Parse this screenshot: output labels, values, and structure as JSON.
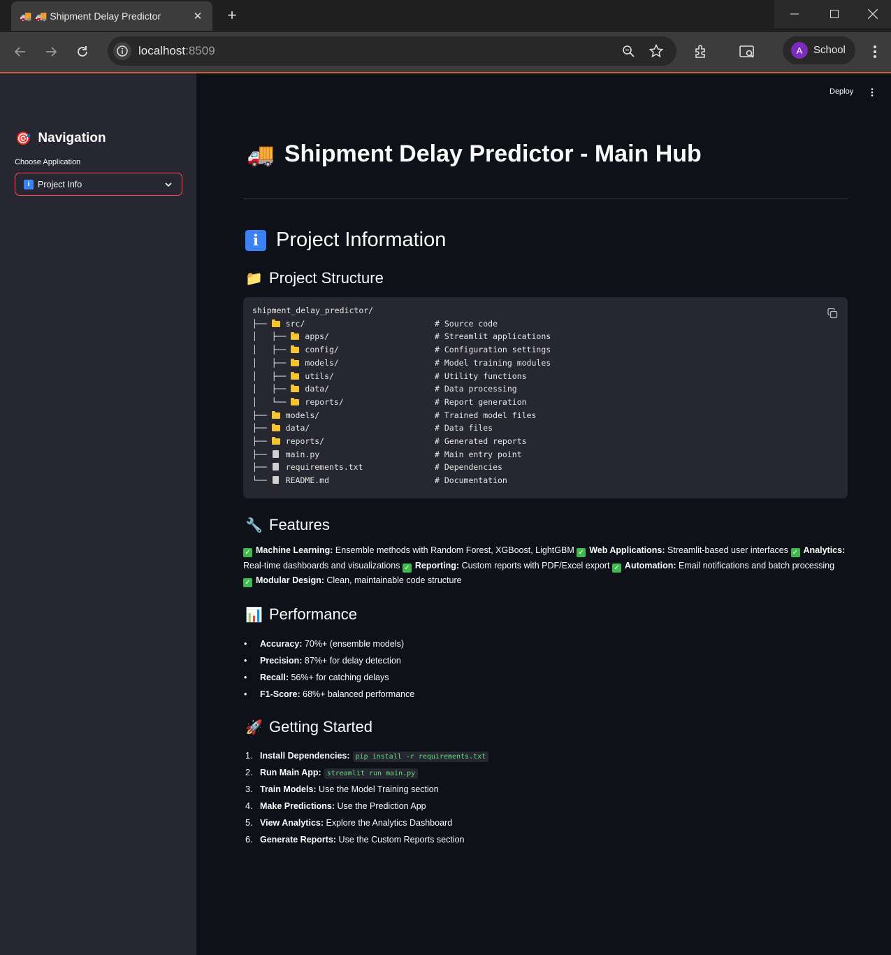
{
  "browser": {
    "tab_title": "🚚 Shipment Delay Predictor",
    "url_host": "localhost",
    "url_port": ":8509",
    "profile_initial": "A",
    "profile_name": "School"
  },
  "header": {
    "deploy_label": "Deploy"
  },
  "sidebar": {
    "title": "Navigation",
    "title_emoji": "🎯",
    "select_label": "Choose Application",
    "select_value": "Project Info"
  },
  "main": {
    "title": "Shipment Delay Predictor - Main Hub",
    "title_emoji": "🚚",
    "section_title": "Project Information",
    "structure_heading": "Project Structure",
    "structure_emoji": "📁",
    "structure_lines": [
      {
        "prefix": "shipment_delay_predictor/",
        "icon": "none",
        "name": "",
        "comment": ""
      },
      {
        "prefix": "├── ",
        "icon": "folder",
        "name": "src/",
        "comment": "# Source code"
      },
      {
        "prefix": "│   ├── ",
        "icon": "folder",
        "name": "apps/",
        "comment": "# Streamlit applications"
      },
      {
        "prefix": "│   ├── ",
        "icon": "folder",
        "name": "config/",
        "comment": "# Configuration settings"
      },
      {
        "prefix": "│   ├── ",
        "icon": "folder",
        "name": "models/",
        "comment": "# Model training modules"
      },
      {
        "prefix": "│   ├── ",
        "icon": "folder",
        "name": "utils/",
        "comment": "# Utility functions"
      },
      {
        "prefix": "│   ├── ",
        "icon": "folder",
        "name": "data/",
        "comment": "# Data processing"
      },
      {
        "prefix": "│   └── ",
        "icon": "folder",
        "name": "reports/",
        "comment": "# Report generation"
      },
      {
        "prefix": "├── ",
        "icon": "folder",
        "name": "models/",
        "comment": "# Trained model files"
      },
      {
        "prefix": "├── ",
        "icon": "folder",
        "name": "data/",
        "comment": "# Data files"
      },
      {
        "prefix": "├── ",
        "icon": "folder",
        "name": "reports/",
        "comment": "# Generated reports"
      },
      {
        "prefix": "├── ",
        "icon": "file",
        "name": "main.py",
        "comment": "# Main entry point"
      },
      {
        "prefix": "├── ",
        "icon": "file",
        "name": "requirements.txt",
        "comment": "# Dependencies"
      },
      {
        "prefix": "└── ",
        "icon": "file",
        "name": "README.md",
        "comment": "# Documentation"
      }
    ],
    "features_heading": "Features",
    "features_emoji": "🔧",
    "features": [
      {
        "label": "Machine Learning",
        "text": "Ensemble methods with Random Forest, XGBoost, LightGBM"
      },
      {
        "label": "Web Applications",
        "text": "Streamlit-based user interfaces"
      },
      {
        "label": "Analytics",
        "text": "Real-time dashboards and visualizations"
      },
      {
        "label": "Reporting",
        "text": "Custom reports with PDF/Excel export"
      },
      {
        "label": "Automation",
        "text": "Email notifications and batch processing"
      },
      {
        "label": "Modular Design",
        "text": "Clean, maintainable code structure"
      }
    ],
    "performance_heading": "Performance",
    "performance_emoji": "📊",
    "performance": [
      {
        "label": "Accuracy",
        "text": "70%+ (ensemble models)"
      },
      {
        "label": "Precision",
        "text": "87%+ for delay detection"
      },
      {
        "label": "Recall",
        "text": "56%+ for catching delays"
      },
      {
        "label": "F1-Score",
        "text": "68%+ balanced performance"
      }
    ],
    "getting_started_heading": "Getting Started",
    "getting_started_emoji": "🚀",
    "steps": [
      {
        "num": "1.",
        "label": "Install Dependencies",
        "text": "",
        "code": "pip install -r requirements.txt"
      },
      {
        "num": "2.",
        "label": "Run Main App",
        "text": "",
        "code": "streamlit run main.py"
      },
      {
        "num": "3.",
        "label": "Train Models",
        "text": "Use the Model Training section",
        "code": ""
      },
      {
        "num": "4.",
        "label": "Make Predictions",
        "text": "Use the Prediction App",
        "code": ""
      },
      {
        "num": "5.",
        "label": "View Analytics",
        "text": "Explore the Analytics Dashboard",
        "code": ""
      },
      {
        "num": "6.",
        "label": "Generate Reports",
        "text": "Use the Custom Reports section",
        "code": ""
      }
    ]
  },
  "colors": {
    "accent": "#ff4b4b",
    "sidebar_bg": "#262730",
    "main_bg": "#0e1117",
    "check": "#3fb950"
  }
}
